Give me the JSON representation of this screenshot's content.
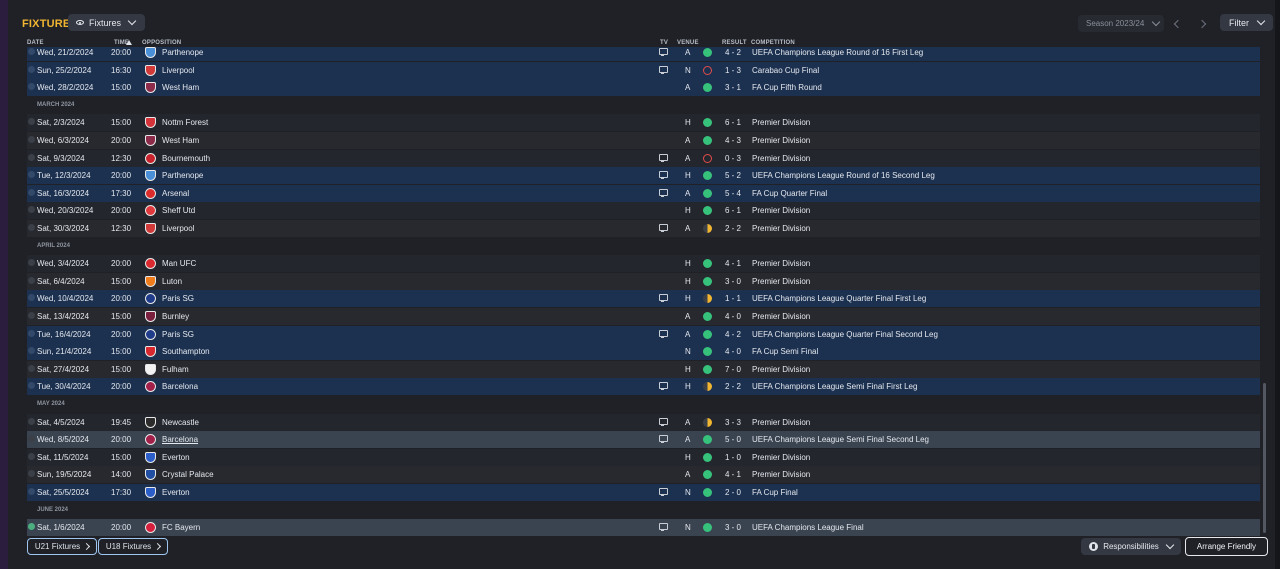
{
  "header": {
    "title": "FIXTURES",
    "view_label": "Fixtures",
    "season_label": "Season 2023/24",
    "filter_label": "Filter"
  },
  "columns": {
    "date": "DATE",
    "time": "TIME",
    "opposition": "OPPOSITION",
    "tv": "TV",
    "venue": "VENUE",
    "result": "RESULT",
    "competition": "COMPETITION"
  },
  "rows": [
    {
      "kind": "fixture",
      "style": "blue",
      "date": "Wed, 21/2/2024",
      "time": "20:00",
      "opponent": "Parthenope",
      "crest": "#4a90d9",
      "tv": true,
      "venue": "A",
      "outcome": "win",
      "result": "4 - 2",
      "competition": "UEFA Champions League Round of 16 First Leg"
    },
    {
      "kind": "fixture",
      "style": "blue",
      "date": "Sun, 25/2/2024",
      "time": "16:30",
      "opponent": "Liverpool",
      "crest": "#d23a3a",
      "tv": true,
      "venue": "N",
      "outcome": "loss",
      "result": "1 - 3",
      "competition": "Carabao Cup Final"
    },
    {
      "kind": "fixture",
      "style": "blue",
      "date": "Wed, 28/2/2024",
      "time": "15:00",
      "opponent": "West Ham",
      "crest": "#8c2c4a",
      "tv": false,
      "venue": "A",
      "outcome": "win",
      "result": "3 - 1",
      "competition": "FA Cup Fifth Round"
    },
    {
      "kind": "month",
      "label": "MARCH 2024"
    },
    {
      "kind": "fixture",
      "style": "dark",
      "date": "Sat, 2/3/2024",
      "time": "15:00",
      "opponent": "Nottm Forest",
      "crest": "#d4333a",
      "tv": false,
      "venue": "H",
      "outcome": "win",
      "result": "6 - 1",
      "competition": "Premier Division"
    },
    {
      "kind": "fixture",
      "style": "alt",
      "date": "Wed, 6/3/2024",
      "time": "20:00",
      "opponent": "West Ham",
      "crest": "#8c2c4a",
      "tv": false,
      "venue": "A",
      "outcome": "win",
      "result": "4 - 3",
      "competition": "Premier Division"
    },
    {
      "kind": "fixture",
      "style": "dark",
      "date": "Sat, 9/3/2024",
      "time": "12:30",
      "opponent": "Bournemouth",
      "crest": "#c8232c",
      "tv": true,
      "venue": "A",
      "outcome": "loss",
      "result": "0 - 3",
      "competition": "Premier Division"
    },
    {
      "kind": "fixture",
      "style": "blue",
      "date": "Tue, 12/3/2024",
      "time": "20:00",
      "opponent": "Parthenope",
      "crest": "#4a90d9",
      "tv": true,
      "venue": "H",
      "outcome": "win",
      "result": "5 - 2",
      "competition": "UEFA Champions League Round of 16 Second Leg"
    },
    {
      "kind": "fixture",
      "style": "blue",
      "date": "Sat, 16/3/2024",
      "time": "17:30",
      "opponent": "Arsenal",
      "crest": "#db2b2b",
      "tv": true,
      "venue": "A",
      "outcome": "win",
      "result": "5 - 4",
      "competition": "FA Cup Quarter Final"
    },
    {
      "kind": "fixture",
      "style": "dark",
      "date": "Wed, 20/3/2024",
      "time": "20:00",
      "opponent": "Sheff Utd",
      "crest": "#e0393e",
      "tv": false,
      "venue": "H",
      "outcome": "win",
      "result": "6 - 1",
      "competition": "Premier Division"
    },
    {
      "kind": "fixture",
      "style": "alt",
      "date": "Sat, 30/3/2024",
      "time": "12:30",
      "opponent": "Liverpool",
      "crest": "#d23a3a",
      "tv": true,
      "venue": "A",
      "outcome": "draw",
      "result": "2 - 2",
      "competition": "Premier Division"
    },
    {
      "kind": "month",
      "label": "APRIL 2024"
    },
    {
      "kind": "fixture",
      "style": "dark",
      "date": "Wed, 3/4/2024",
      "time": "20:00",
      "opponent": "Man UFC",
      "crest": "#da2a2f",
      "tv": false,
      "venue": "H",
      "outcome": "win",
      "result": "4 - 1",
      "competition": "Premier Division"
    },
    {
      "kind": "fixture",
      "style": "alt",
      "date": "Sat, 6/4/2024",
      "time": "15:00",
      "opponent": "Luton",
      "crest": "#f07c1b",
      "tv": false,
      "venue": "H",
      "outcome": "win",
      "result": "3 - 0",
      "competition": "Premier Division"
    },
    {
      "kind": "fixture",
      "style": "blue",
      "date": "Wed, 10/4/2024",
      "time": "20:00",
      "opponent": "Paris SG",
      "crest": "#1f3c8a",
      "tv": true,
      "venue": "H",
      "outcome": "draw",
      "result": "1 - 1",
      "competition": "UEFA Champions League Quarter Final First Leg"
    },
    {
      "kind": "fixture",
      "style": "alt",
      "date": "Sat, 13/4/2024",
      "time": "15:00",
      "opponent": "Burnley",
      "crest": "#7a1f3d",
      "tv": false,
      "venue": "A",
      "outcome": "win",
      "result": "4 - 0",
      "competition": "Premier Division"
    },
    {
      "kind": "fixture",
      "style": "blue",
      "date": "Tue, 16/4/2024",
      "time": "20:00",
      "opponent": "Paris SG",
      "crest": "#1f3c8a",
      "tv": true,
      "venue": "A",
      "outcome": "win",
      "result": "4 - 2",
      "competition": "UEFA Champions League Quarter Final Second Leg"
    },
    {
      "kind": "fixture",
      "style": "blue",
      "date": "Sun, 21/4/2024",
      "time": "15:00",
      "opponent": "Southampton",
      "crest": "#d7272f",
      "tv": false,
      "venue": "N",
      "outcome": "win",
      "result": "4 - 0",
      "competition": "FA Cup Semi Final"
    },
    {
      "kind": "fixture",
      "style": "alt",
      "date": "Sat, 27/4/2024",
      "time": "15:00",
      "opponent": "Fulham",
      "crest": "#f2f2f2",
      "tv": false,
      "venue": "H",
      "outcome": "win",
      "result": "7 - 0",
      "competition": "Premier Division"
    },
    {
      "kind": "fixture",
      "style": "blue",
      "date": "Tue, 30/4/2024",
      "time": "20:00",
      "opponent": "Barcelona",
      "crest": "#a3204a",
      "tv": true,
      "venue": "H",
      "outcome": "draw",
      "result": "2 - 2",
      "competition": "UEFA Champions League Semi Final First Leg"
    },
    {
      "kind": "month",
      "label": "MAY 2024"
    },
    {
      "kind": "fixture",
      "style": "dark",
      "date": "Sat, 4/5/2024",
      "time": "19:45",
      "opponent": "Newcastle",
      "crest": "#2b2b2b",
      "tv": true,
      "venue": "A",
      "outcome": "draw",
      "result": "3 - 3",
      "competition": "Premier Division"
    },
    {
      "kind": "fixture",
      "style": "sel",
      "date": "Wed, 8/5/2024",
      "time": "20:00",
      "opponent": "Barcelona",
      "crest": "#a3204a",
      "tv": true,
      "venue": "A",
      "outcome": "win",
      "result": "5 - 0",
      "competition": "UEFA Champions League Semi Final Second Leg",
      "link": true
    },
    {
      "kind": "fixture",
      "style": "dark",
      "date": "Sat, 11/5/2024",
      "time": "15:00",
      "opponent": "Everton",
      "crest": "#2c5ec9",
      "tv": false,
      "venue": "H",
      "outcome": "win",
      "result": "1 - 0",
      "competition": "Premier Division"
    },
    {
      "kind": "fixture",
      "style": "alt",
      "date": "Sun, 19/5/2024",
      "time": "14:00",
      "opponent": "Crystal Palace",
      "crest": "#1f4ea3",
      "tv": false,
      "venue": "A",
      "outcome": "win",
      "result": "4 - 1",
      "competition": "Premier Division"
    },
    {
      "kind": "fixture",
      "style": "blue",
      "date": "Sat, 25/5/2024",
      "time": "17:30",
      "opponent": "Everton",
      "crest": "#2c5ec9",
      "tv": true,
      "venue": "N",
      "outcome": "win",
      "result": "2 - 0",
      "competition": "FA Cup Final"
    },
    {
      "kind": "month",
      "label": "JUNE 2024"
    },
    {
      "kind": "fixture",
      "style": "sel",
      "date": "Sat, 1/6/2024",
      "time": "20:00",
      "opponent": "FC Bayern",
      "crest": "#d61f3c",
      "tv": true,
      "venue": "N",
      "outcome": "win",
      "result": "3 - 0",
      "competition": "UEFA Champions League Final",
      "checked": true
    }
  ],
  "footer": {
    "u21_label": "U21 Fixtures",
    "u18_label": "U18 Fixtures",
    "responsibilities_label": "Responsibilities",
    "arrange_label": "Arrange Friendly"
  },
  "colors": {
    "accent": "#f0b531",
    "win": "#37c27c",
    "loss": "#e54b4b",
    "draw": "#f0b531",
    "cup_row": "#1c3150"
  }
}
